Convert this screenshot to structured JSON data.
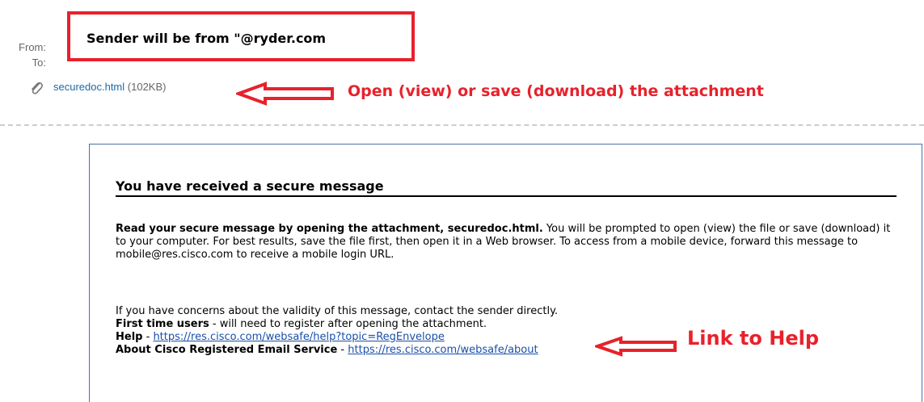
{
  "header": {
    "from_label": "From:",
    "to_label": "To:"
  },
  "attachment": {
    "icon": "paperclip-icon",
    "filename": "securedoc.html",
    "size": "(102KB)"
  },
  "annotations": {
    "sender_note": "Sender will be from \"@ryder.com",
    "attachment_note": "Open (view) or save (download) the attachment",
    "help_note": "Link to Help",
    "color": "#e8212b"
  },
  "message": {
    "heading": "You have received a secure message",
    "intro_bold": "Read your secure message by opening the attachment, securedoc.html.",
    "intro_rest": " You will be prompted to open (view) the file or save (download) it to your computer. For best results, save the file first, then open it in a Web browser. To access from a mobile device, forward this message to mobile@res.cisco.com to receive a mobile login URL.",
    "concerns": "If you have concerns about the validity of this message, contact the sender directly.",
    "first_time_bold": "First time users",
    "first_time_rest": " - will need to register after opening the attachment.",
    "help_bold": "Help",
    "help_sep": " - ",
    "help_url": "https://res.cisco.com/websafe/help?topic=RegEnvelope",
    "about_bold": "About Cisco Registered Email Service",
    "about_sep": " - ",
    "about_url": "https://res.cisco.com/websafe/about"
  },
  "colors": {
    "link": "#1a4fa8",
    "frame_border": "#4b6fad"
  }
}
